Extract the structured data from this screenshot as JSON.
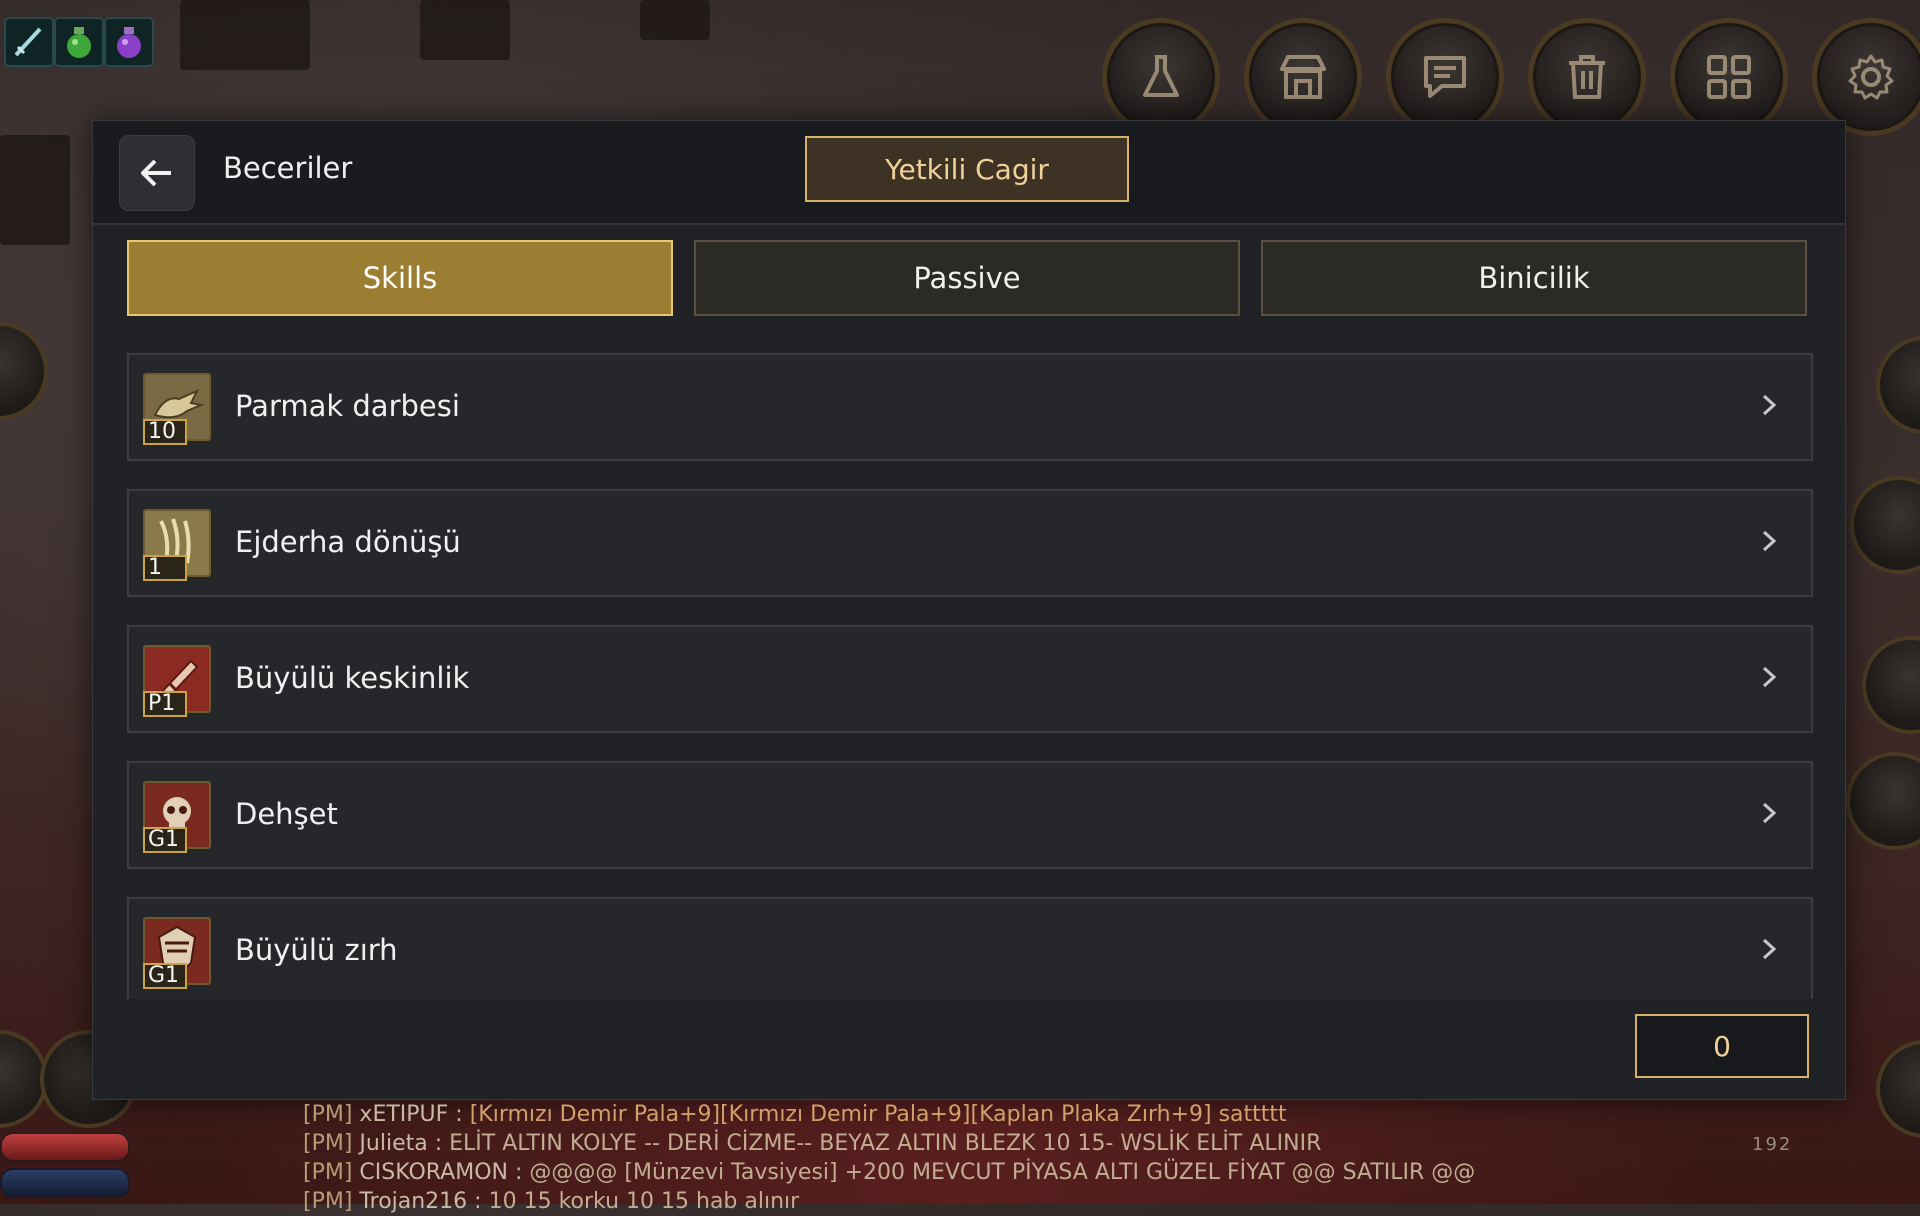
{
  "quick_slots": [
    {
      "icon": "sword-icon"
    },
    {
      "icon": "green-potion-icon"
    },
    {
      "icon": "purple-potion-icon"
    }
  ],
  "hud_buttons": [
    {
      "icon": "flask-icon"
    },
    {
      "icon": "shop-icon"
    },
    {
      "icon": "chat-icon"
    },
    {
      "icon": "trash-icon"
    },
    {
      "icon": "grid-menu-icon"
    },
    {
      "icon": "gear-icon"
    }
  ],
  "panel": {
    "title": "Beceriler",
    "gm_button": "Yetkili Cagir",
    "tabs": [
      "Skills",
      "Passive",
      "Binicilik"
    ],
    "active_tab": "Skills",
    "skills": [
      {
        "name": "Parmak darbesi",
        "level": "10",
        "icon": "finger-strike-icon"
      },
      {
        "name": "Ejderha dönüşü",
        "level": "1",
        "icon": "dragon-swirl-icon"
      },
      {
        "name": "Büyülü keskinlik",
        "level": "P1",
        "icon": "enchanted-blade-icon"
      },
      {
        "name": "Dehşet",
        "level": "G1",
        "icon": "skull-icon"
      },
      {
        "name": "Büyülü zırh",
        "level": "G1",
        "icon": "enchanted-armor-icon"
      }
    ],
    "skill_points": "0"
  },
  "chat": {
    "lines": [
      {
        "prefix": "[PM]",
        "sender": "xETIPUF :",
        "message": "[Kırmızı Demir Pala+9][Kırmızı Demir Pala+9][Kaplan Plaka Zırh+9] sattttt"
      },
      {
        "prefix": "[PM]",
        "sender": "Julieta :",
        "message": "ELİT ALTIN KOLYE -- DERİ CİZME-- BEYAZ ALTIN BLEZK 10 15- WSLİK ELİT ALINIR"
      },
      {
        "prefix": "[PM]",
        "sender": "CISKORAMON :",
        "message": "@@@@ [Münzevi Tavsiyesi] +200 MEVCUT PİYASA ALTI GÜZEL FİYAT @@ SATILIR @@"
      },
      {
        "prefix": "[PM]",
        "sender": "Trojan216 :",
        "message": "10 15 korku 10 15 hab alınır"
      }
    ]
  },
  "hud_readout": "192",
  "colors": {
    "accent_gold": "#d7b06a",
    "active_tab": "#9c7e33",
    "panel_bg": "#212226"
  }
}
